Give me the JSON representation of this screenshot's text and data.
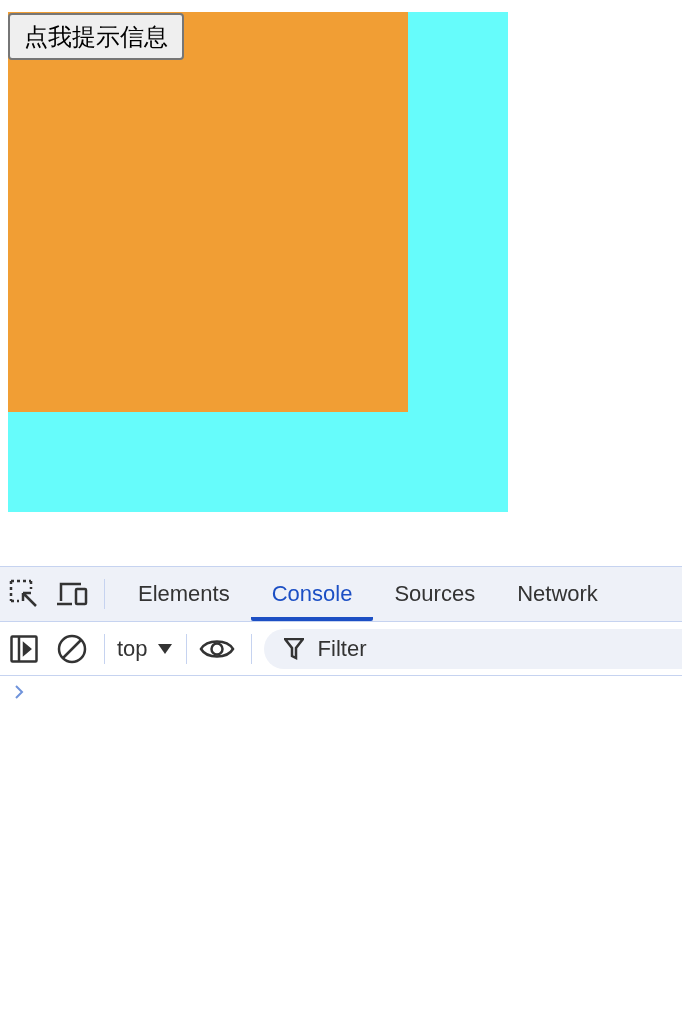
{
  "page": {
    "button": {
      "label": "点我提示信息"
    }
  },
  "devtools": {
    "tabs": [
      {
        "label": "Elements",
        "selected": false
      },
      {
        "label": "Console",
        "selected": true
      },
      {
        "label": "Sources",
        "selected": false
      },
      {
        "label": "Network",
        "selected": false
      }
    ],
    "context": "top",
    "filter": {
      "placeholder": "Filter"
    }
  }
}
